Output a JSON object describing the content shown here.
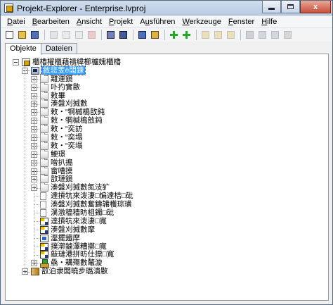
{
  "window": {
    "title": "Projekt-Explorer - Enterprise.lvproj",
    "buttons": {
      "minimize": "",
      "maximize": "",
      "close": "x"
    }
  },
  "menu": [
    {
      "label": "Datei",
      "u": "D",
      "rest": "atei"
    },
    {
      "label": "Bearbeiten",
      "u": "B",
      "rest": "earbeiten"
    },
    {
      "label": "Ansicht",
      "u": "A",
      "rest": "nsicht"
    },
    {
      "label": "Projekt",
      "u": "P",
      "rest": "rojekt"
    },
    {
      "label": "Ausführen",
      "u": "u",
      "pre": "A",
      "rest": "sführen"
    },
    {
      "label": "Werkzeuge",
      "u": "W",
      "rest": "erkzeuge"
    },
    {
      "label": "Fenster",
      "u": "F",
      "rest": "enster"
    },
    {
      "label": "Hilfe",
      "u": "H",
      "rest": "ilfe"
    }
  ],
  "toolbar": {
    "icons": [
      "new-icon",
      "open-icon",
      "save-all-icon",
      "cut-icon",
      "copy-icon",
      "paste-icon",
      "delete-icon",
      "build-icon",
      "deploy-icon",
      "view-icon",
      "dependency-icon",
      "add-icon",
      "add-folder-icon",
      "rename-icon",
      "refresh-icon",
      "properties-icon",
      "find-icon",
      "undo-icon",
      "redo-icon",
      "help-icon"
    ]
  },
  "tabs": [
    {
      "label": "Objekte",
      "active": true
    },
    {
      "label": "Dateien",
      "active": false
    }
  ],
  "tree": [
    {
      "depth": 0,
      "icon": "project",
      "exp": "minus",
      "label": "櫃櫓櫂櫃藉禱緯櫛櫨媿櫃櫓"
    },
    {
      "depth": 1,
      "icon": "target",
      "exp": "minus",
      "label": "敘悲芰ё闆鍊",
      "selected": true
    },
    {
      "depth": 2,
      "icon": "folder",
      "exp": "plus",
      "label": "離運鏡"
    },
    {
      "depth": 2,
      "icon": "folder",
      "exp": "plus",
      "label": "卟扚實敭"
    },
    {
      "depth": 2,
      "icon": "folder",
      "exp": "plus",
      "label": "敕畢"
    },
    {
      "depth": 2,
      "icon": "folder",
      "exp": "plus",
      "label": "湊盤刈搣數"
    },
    {
      "depth": 2,
      "icon": "folder",
      "exp": "plus",
      "label": "敕・“犅槭槝敨鈍"
    },
    {
      "depth": 2,
      "icon": "folder",
      "exp": "plus",
      "label": "敕・犅槭槝敨鈍"
    },
    {
      "depth": 2,
      "icon": "folder",
      "exp": "plus",
      "label": "敕・“奕訪"
    },
    {
      "depth": 2,
      "icon": "folder",
      "exp": "plus",
      "label": "敕・“奕塌"
    },
    {
      "depth": 2,
      "icon": "folder",
      "exp": "plus",
      "label": "敕・“奕塌"
    },
    {
      "depth": 2,
      "icon": "folder",
      "exp": "plus",
      "label": "鯁璟"
    },
    {
      "depth": 2,
      "icon": "folder",
      "exp": "plus",
      "label": "噌扒搗"
    },
    {
      "depth": 2,
      "icon": "folder",
      "exp": "plus",
      "label": "畲嘈摸"
    },
    {
      "depth": 2,
      "icon": "folder",
      "exp": "plus",
      "label": "敨璉鏡"
    },
    {
      "depth": 2,
      "icon": "folder",
      "exp": "plus",
      "label": "湊盤刈搣數氮汥犷"
    },
    {
      "depth": 2,
      "icon": "file",
      "exp": "none",
      "label": "達摃牨來泼淒□惼達桔□砒"
    },
    {
      "depth": 2,
      "icon": "file",
      "exp": "none",
      "label": "湊盤刈搣數奮鑄韛穫琮璜"
    },
    {
      "depth": 2,
      "icon": "file",
      "exp": "none",
      "label": "潩澂穡穡昉柤鐲□砒"
    },
    {
      "depth": 2,
      "icon": "vi",
      "exp": "none",
      "label": "達摃牨來泼淒□寬"
    },
    {
      "depth": 2,
      "icon": "vi",
      "exp": "none",
      "label": "湊盤刈搣數摩"
    },
    {
      "depth": 2,
      "icon": "vi2",
      "exp": "none",
      "label": "瀣擺鐵摩"
    },
    {
      "depth": 2,
      "icon": "vi",
      "exp": "none",
      "label": "撲漷鑢澤糟擲□寬"
    },
    {
      "depth": 2,
      "icon": "vi",
      "exp": "none",
      "label": "敲璉港拼昉仕摽□寬"
    },
    {
      "depth": 2,
      "icon": "tree",
      "exp": "plus",
      "label": "驫・耩殤數鼇漩"
    },
    {
      "depth": 1,
      "icon": "lib",
      "exp": "plus",
      "label": "敨泊隶闆曉步璐潰敭"
    }
  ]
}
